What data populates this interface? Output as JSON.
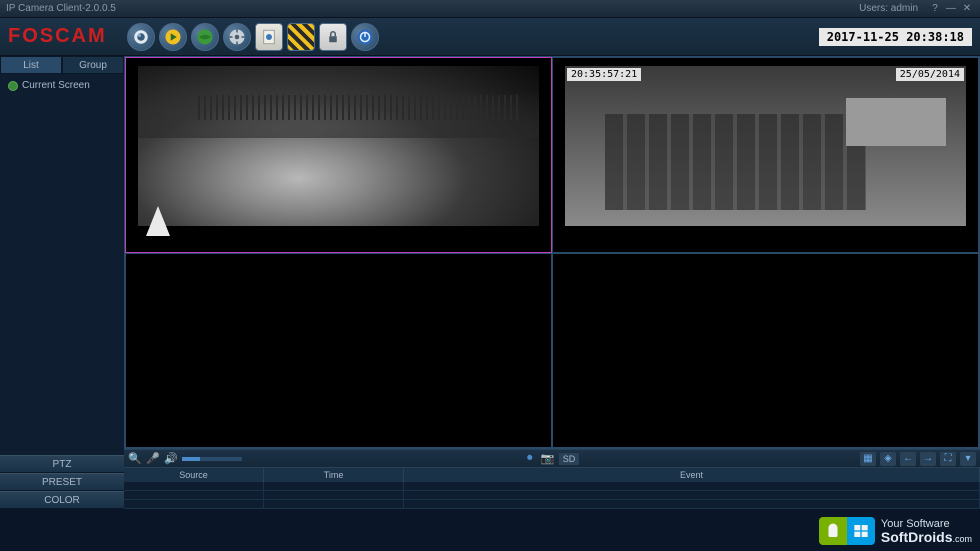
{
  "titlebar": {
    "title": "IP Camera Client-2.0.0.5",
    "users_label": "Users: admin"
  },
  "header": {
    "logo": "FOSCAM",
    "datetime": "2017-11-25 20:38:18",
    "toolbar_icons": [
      "webcam",
      "play",
      "globe",
      "gear",
      "report",
      "lock",
      "power"
    ]
  },
  "sidebar": {
    "tabs": {
      "list": "List",
      "group": "Group"
    },
    "tree": {
      "current_screen": "Current Screen"
    },
    "buttons": {
      "ptz": "PTZ",
      "preset": "PRESET",
      "color": "COLOR"
    }
  },
  "feeds": {
    "cam2": {
      "time": "20:35:57:21",
      "date": "25/05/2014"
    }
  },
  "controlbar": {
    "sd": "SD"
  },
  "event_table": {
    "cols": {
      "source": "Source",
      "time": "Time",
      "event": "Event"
    }
  },
  "watermark": {
    "line1": "Your Software",
    "line2": "SoftDroids",
    "suffix": ".com"
  }
}
